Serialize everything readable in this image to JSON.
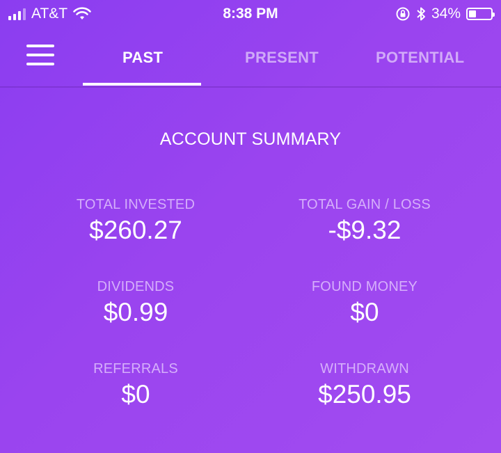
{
  "status_bar": {
    "carrier": "AT&T",
    "time": "8:38 PM",
    "battery_percent": "34%",
    "battery_level": 0.34
  },
  "nav": {
    "tabs": [
      {
        "label": "PAST",
        "active": true
      },
      {
        "label": "PRESENT",
        "active": false
      },
      {
        "label": "POTENTIAL",
        "active": false
      }
    ]
  },
  "summary": {
    "title": "ACCOUNT SUMMARY",
    "stats": [
      {
        "label": "TOTAL INVESTED",
        "value": "$260.27"
      },
      {
        "label": "TOTAL GAIN / LOSS",
        "value": "-$9.32"
      },
      {
        "label": "DIVIDENDS",
        "value": "$0.99"
      },
      {
        "label": "FOUND MONEY",
        "value": "$0"
      },
      {
        "label": "REFERRALS",
        "value": "$0"
      },
      {
        "label": "WITHDRAWN",
        "value": "$250.95"
      }
    ]
  }
}
